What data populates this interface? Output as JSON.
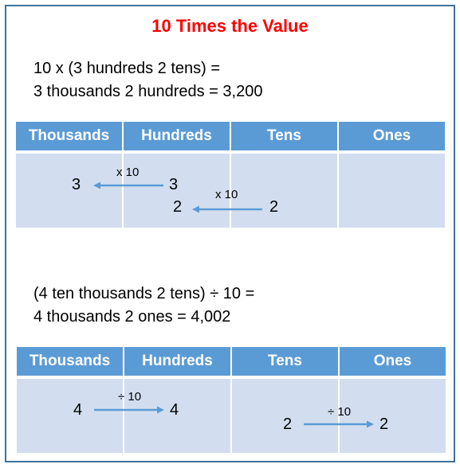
{
  "title": "10 Times the Value",
  "colors": {
    "title": "#ff0000",
    "frame_border": "#41719c",
    "header_bg": "#5b9bd5",
    "cell_bg": "#d2deef",
    "arrow": "#5b9bd5"
  },
  "section1": {
    "equation_line1": "10 x (3 hundreds 2 tens) =",
    "equation_line2": "3 thousands 2 hundreds = 3,200",
    "headers": [
      "Thousands",
      "Hundreds",
      "Tens",
      "Ones"
    ],
    "moves": [
      {
        "from_value": "3",
        "from_column": "Hundreds",
        "to_value": "3",
        "to_column": "Thousands",
        "operation": "x 10",
        "direction": "left"
      },
      {
        "from_value": "2",
        "from_column": "Tens",
        "to_value": "2",
        "to_column": "Hundreds",
        "operation": "x 10",
        "direction": "left"
      }
    ]
  },
  "section2": {
    "equation_line1": "(4 ten thousands 2 tens) ÷ 10 =",
    "equation_line2": "4 thousands 2 ones = 4,002",
    "headers": [
      "Thousands",
      "Hundreds",
      "Tens",
      "Ones"
    ],
    "moves": [
      {
        "from_value": "4",
        "from_column": "Thousands",
        "to_value": "4",
        "to_column": "Hundreds",
        "operation": "÷ 10",
        "direction": "right"
      },
      {
        "from_value": "2",
        "from_column": "Tens",
        "to_value": "2",
        "to_column": "Ones",
        "operation": "÷ 10",
        "direction": "right"
      }
    ]
  }
}
